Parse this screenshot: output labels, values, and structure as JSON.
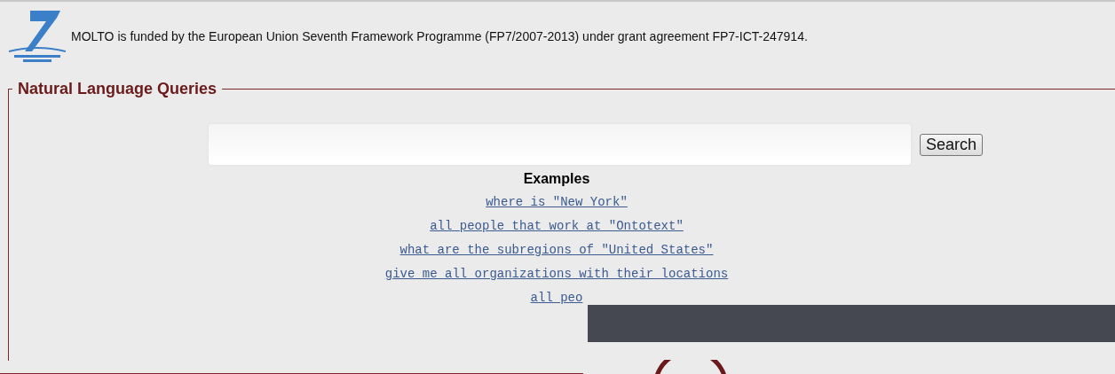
{
  "funding": {
    "text": "MOLTO is funded by the European Union Seventh Framework Programme (FP7/2007-2013) under grant agreement FP7-ICT-247914."
  },
  "queries": {
    "legend": "Natural Language Queries",
    "search_button": "Search",
    "examples_title": "Examples",
    "examples": [
      "where is \"New York\"",
      "all people that work at \"Ontotext\"",
      "what are the subregions of \"United States\"",
      "give me all organizations with their locations",
      "all peo"
    ]
  }
}
